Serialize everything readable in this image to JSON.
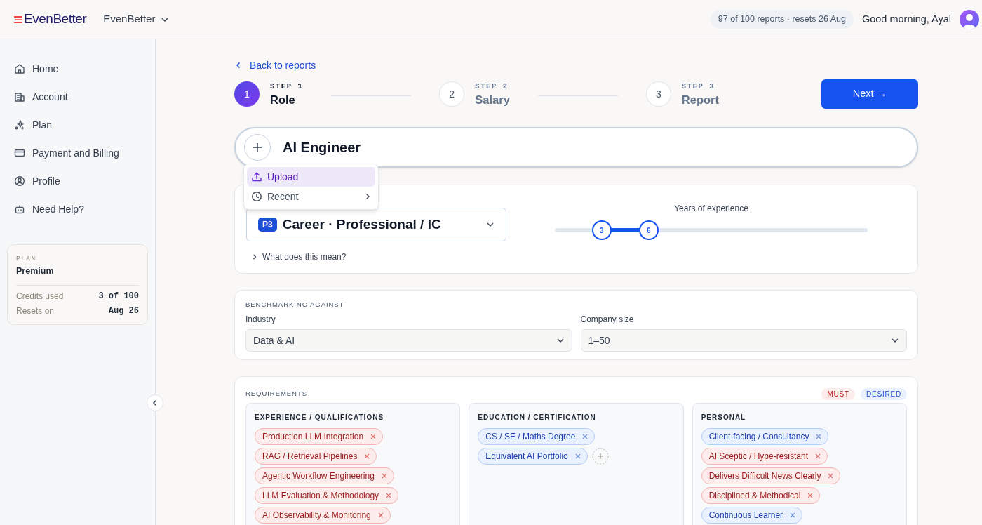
{
  "header": {
    "brand": "EvenBetter",
    "workspace": "EvenBetter",
    "quota": "97 of 100 reports · resets 26 Aug",
    "greeting": "Good morning, Ayal"
  },
  "sidebar": {
    "items": [
      {
        "label": "Home"
      },
      {
        "label": "Account"
      },
      {
        "label": "Plan"
      },
      {
        "label": "Payment and Billing"
      },
      {
        "label": "Profile"
      },
      {
        "label": "Need Help?"
      }
    ],
    "plan": {
      "caption": "PLAN",
      "name": "Premium",
      "rows": [
        {
          "label": "Credits used",
          "value": "3 of 100"
        },
        {
          "label": "Resets on",
          "value": "Aug 26"
        }
      ]
    }
  },
  "back_link": "Back to reports",
  "steps": [
    {
      "number": "1",
      "caption": "STEP 1",
      "label": "Role",
      "selected": true
    },
    {
      "number": "2",
      "caption": "STEP 2",
      "label": "Salary",
      "selected": false
    },
    {
      "number": "3",
      "caption": "STEP 3",
      "label": "Report",
      "selected": false
    }
  ],
  "next_button": "Next →",
  "role_field": {
    "value": "AI Engineer"
  },
  "add_menu": [
    {
      "label": "Upload",
      "submenu": false,
      "selected": true
    },
    {
      "label": "Recent",
      "submenu": true,
      "selected": false
    }
  ],
  "level": {
    "badge": "P3",
    "value": "Career · Professional / IC",
    "help": "What does this mean?"
  },
  "experience": {
    "label": "Years of experience",
    "thumbs": [
      {
        "label": "3",
        "level": 0.15
      },
      {
        "label": "6",
        "level": 0.3
      }
    ]
  },
  "benchmark": {
    "title": "BENCHMARKING AGAINST",
    "fields": [
      {
        "label": "Industry",
        "value": "Data & AI"
      },
      {
        "label": "Company size",
        "value": "1–50"
      }
    ]
  },
  "requirements": {
    "title": "REQUIREMENTS",
    "legend": [
      {
        "label": "MUST",
        "kind": "must"
      },
      {
        "label": "DESIRED",
        "kind": "desired"
      }
    ],
    "columns": [
      {
        "title": "EXPERIENCE / QUALIFICATIONS",
        "add_button": false,
        "chips": [
          {
            "label": "Production LLM Integration",
            "kind": "must"
          },
          {
            "label": "RAG / Retrieval Pipelines",
            "kind": "must"
          },
          {
            "label": "Agentic Workflow Engineering",
            "kind": "must"
          },
          {
            "label": "LLM Evaluation & Methodology",
            "kind": "must"
          },
          {
            "label": "AI Observability & Monitoring",
            "kind": "must"
          }
        ]
      },
      {
        "title": "EDUCATION / CERTIFICATION",
        "add_button": true,
        "chips": [
          {
            "label": "CS / SE / Maths Degree",
            "kind": "desired"
          },
          {
            "label": "Equivalent AI Portfolio",
            "kind": "desired"
          }
        ]
      },
      {
        "title": "PERSONAL",
        "add_button": false,
        "chips": [
          {
            "label": "Client-facing / Consultancy",
            "kind": "desired"
          },
          {
            "label": "AI Sceptic / Hype-resistant",
            "kind": "must"
          },
          {
            "label": "Delivers Difficult News Clearly",
            "kind": "must"
          },
          {
            "label": "Disciplined & Methodical",
            "kind": "must"
          },
          {
            "label": "Continuous Learner",
            "kind": "desired"
          }
        ]
      }
    ]
  }
}
